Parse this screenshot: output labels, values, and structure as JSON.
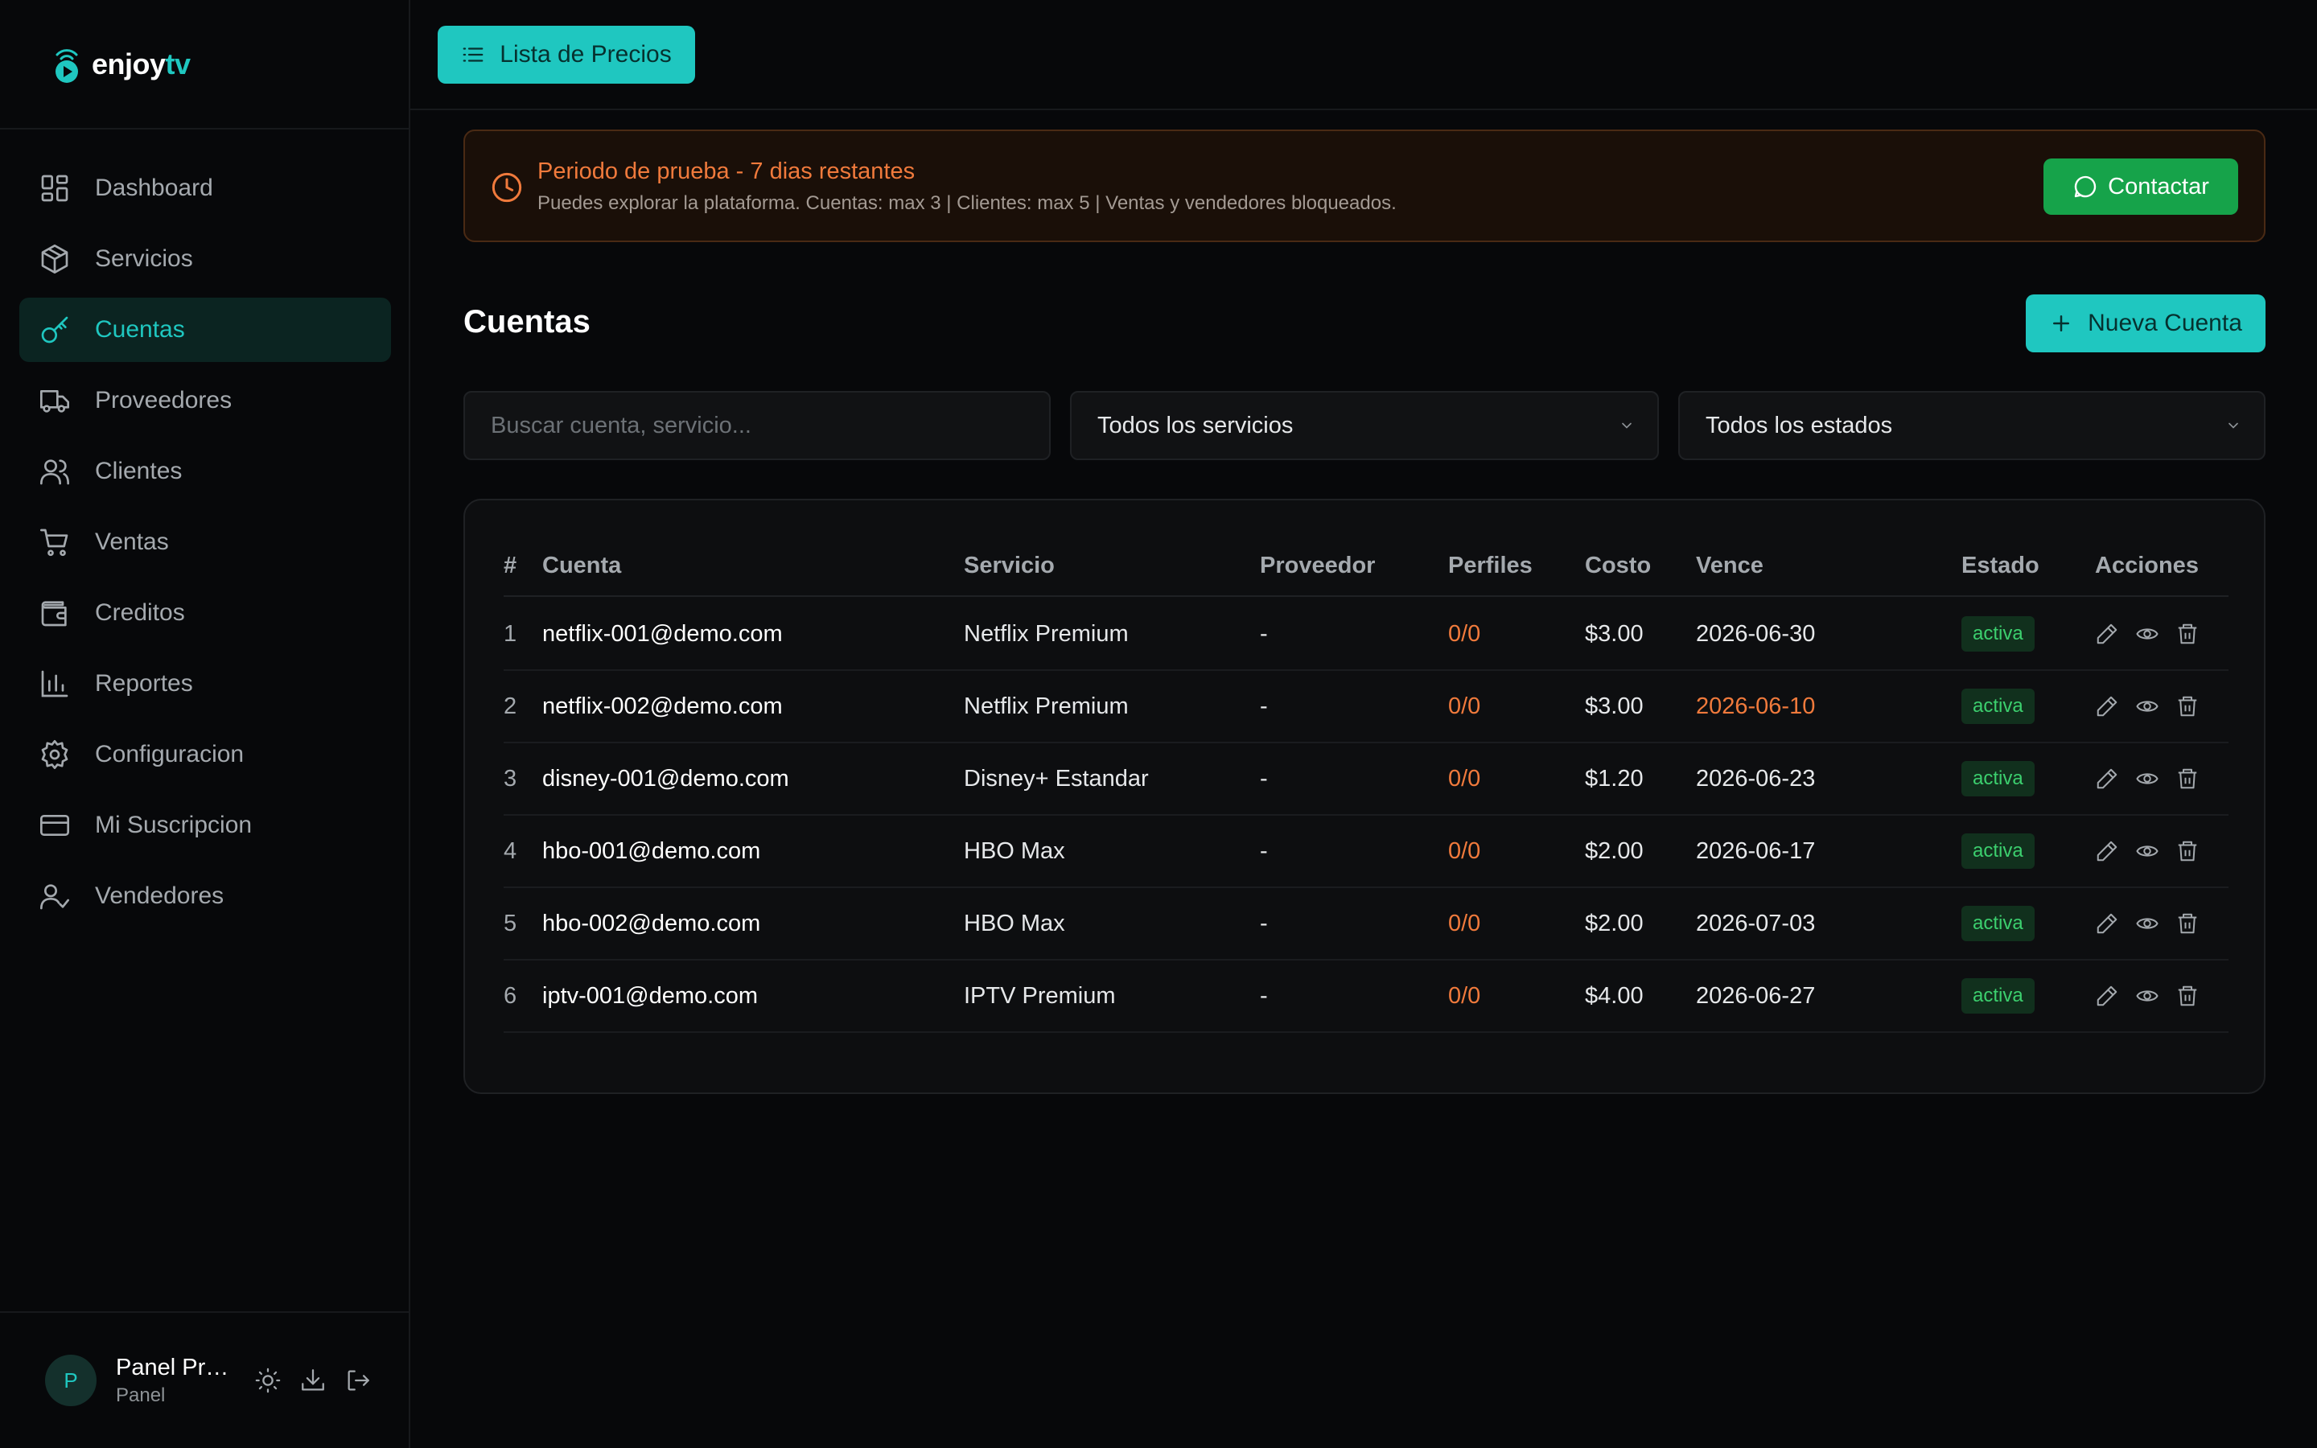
{
  "brand": {
    "name_part1": "enjoy",
    "name_part2": "tv"
  },
  "sidebar": {
    "items": [
      {
        "label": "Dashboard",
        "icon": "dashboard-icon"
      },
      {
        "label": "Servicios",
        "icon": "package-icon"
      },
      {
        "label": "Cuentas",
        "icon": "key-icon",
        "active": true
      },
      {
        "label": "Proveedores",
        "icon": "truck-icon"
      },
      {
        "label": "Clientes",
        "icon": "users-icon"
      },
      {
        "label": "Ventas",
        "icon": "cart-icon"
      },
      {
        "label": "Creditos",
        "icon": "wallet-icon"
      },
      {
        "label": "Reportes",
        "icon": "bar-chart-icon"
      },
      {
        "label": "Configuracion",
        "icon": "gear-icon"
      },
      {
        "label": "Mi Suscripcion",
        "icon": "credit-card-icon"
      },
      {
        "label": "Vendedores",
        "icon": "user-check-icon"
      }
    ]
  },
  "user": {
    "initial": "P",
    "name": "Panel Pru...",
    "role": "Panel"
  },
  "topbar": {
    "price_list_label": "Lista de Precios"
  },
  "banner": {
    "title": "Periodo de prueba - 7 dias restantes",
    "subtitle": "Puedes explorar la plataforma. Cuentas: max 3 | Clientes: max 5 | Ventas y vendedores bloqueados.",
    "contact_label": "Contactar"
  },
  "page": {
    "title": "Cuentas",
    "new_button": "Nueva Cuenta"
  },
  "filters": {
    "search_placeholder": "Buscar cuenta, servicio...",
    "service_select": "Todos los servicios",
    "status_select": "Todos los estados"
  },
  "table": {
    "headers": {
      "num": "#",
      "account": "Cuenta",
      "service": "Servicio",
      "provider": "Proveedor",
      "profiles": "Perfiles",
      "cost": "Costo",
      "expires": "Vence",
      "status": "Estado",
      "actions": "Acciones"
    },
    "rows": [
      {
        "num": "1",
        "account": "netflix-001@demo.com",
        "service": "Netflix Premium",
        "provider": "-",
        "profiles": "0/0",
        "cost": "$3.00",
        "expires": "2026-06-30",
        "status": "activa"
      },
      {
        "num": "2",
        "account": "netflix-002@demo.com",
        "service": "Netflix Premium",
        "provider": "-",
        "profiles": "0/0",
        "cost": "$3.00",
        "expires": "2026-06-10",
        "status": "activa",
        "expires_warning": true
      },
      {
        "num": "3",
        "account": "disney-001@demo.com",
        "service": "Disney+ Estandar",
        "provider": "-",
        "profiles": "0/0",
        "cost": "$1.20",
        "expires": "2026-06-23",
        "status": "activa"
      },
      {
        "num": "4",
        "account": "hbo-001@demo.com",
        "service": "HBO Max",
        "provider": "-",
        "profiles": "0/0",
        "cost": "$2.00",
        "expires": "2026-06-17",
        "status": "activa"
      },
      {
        "num": "5",
        "account": "hbo-002@demo.com",
        "service": "HBO Max",
        "provider": "-",
        "profiles": "0/0",
        "cost": "$2.00",
        "expires": "2026-07-03",
        "status": "activa"
      },
      {
        "num": "6",
        "account": "iptv-001@demo.com",
        "service": "IPTV Premium",
        "provider": "-",
        "profiles": "0/0",
        "cost": "$4.00",
        "expires": "2026-06-27",
        "status": "activa"
      }
    ]
  },
  "colors": {
    "accent": "#1fc7c0",
    "warning": "#f07a3c",
    "success": "#16a34a",
    "background": "#07080a"
  }
}
